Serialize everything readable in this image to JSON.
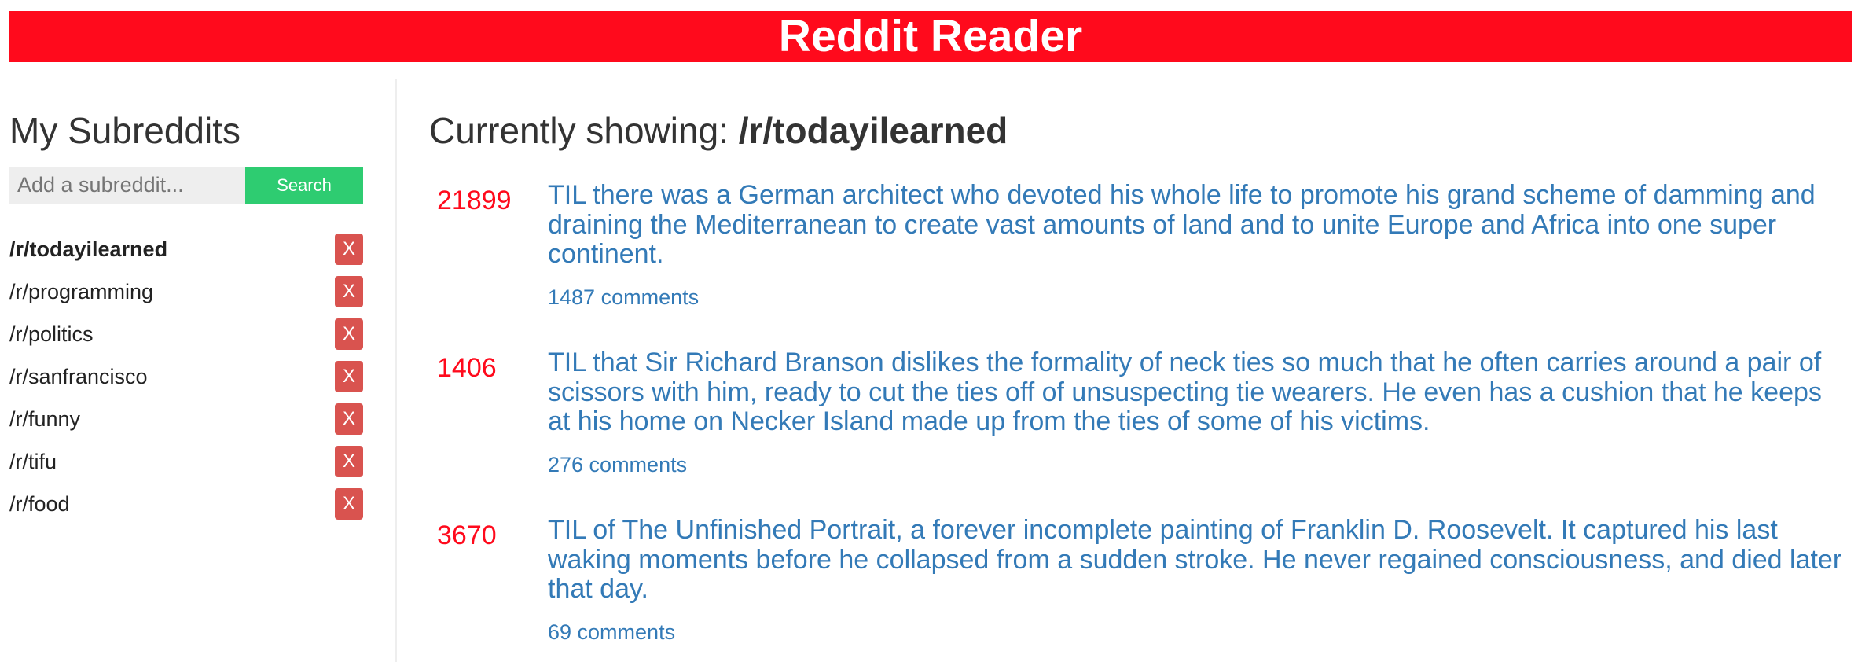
{
  "header": {
    "title": "Reddit Reader",
    "color": "#ff0a1c"
  },
  "sidebar": {
    "heading": "My Subreddits",
    "add_placeholder": "Add a subreddit...",
    "search_label": "Search",
    "remove_label": "X",
    "items": [
      {
        "label": "/r/todayilearned",
        "active": true
      },
      {
        "label": "/r/programming",
        "active": false
      },
      {
        "label": "/r/politics",
        "active": false
      },
      {
        "label": "/r/sanfrancisco",
        "active": false
      },
      {
        "label": "/r/funny",
        "active": false
      },
      {
        "label": "/r/tifu",
        "active": false
      },
      {
        "label": "/r/food",
        "active": false
      }
    ]
  },
  "main": {
    "heading_prefix": "Currently showing: ",
    "current_subreddit": "/r/todayilearned",
    "posts": [
      {
        "score": "21899",
        "title": "TIL there was a German architect who devoted his whole life to promote his grand scheme of damming and draining the Mediterranean to create vast amounts of land and to unite Europe and Africa into one super continent.",
        "comments": "1487 comments"
      },
      {
        "score": "1406",
        "title": "TIL that Sir Richard Branson dislikes the formality of neck ties so much that he often carries around a pair of scissors with him, ready to cut the ties off of unsuspecting tie wearers. He even has a cushion that he keeps at his home on Necker Island made up from the ties of some of his victims.",
        "comments": "276 comments"
      },
      {
        "score": "3670",
        "title": "TIL of The Unfinished Portrait, a forever incomplete painting of Franklin D. Roosevelt. It captured his last waking moments before he collapsed from a sudden stroke. He never regained consciousness, and died later that day.",
        "comments": "69 comments"
      }
    ]
  },
  "colors": {
    "accent_red": "#ff0a1c",
    "link_blue": "#337ab7",
    "search_green": "#2ecc71",
    "remove_red": "#d9534f"
  }
}
